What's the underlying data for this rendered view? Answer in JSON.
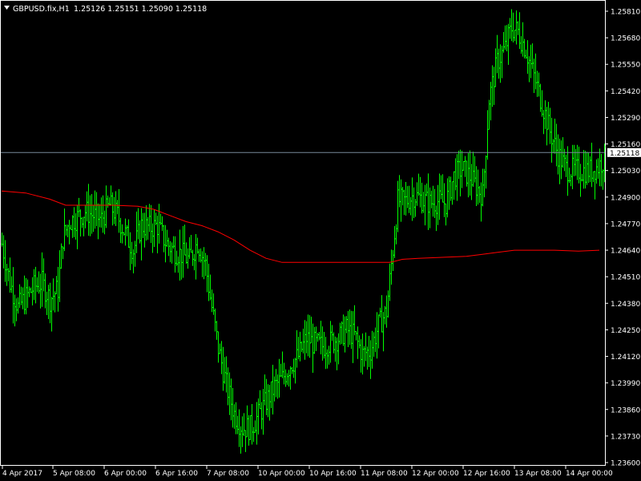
{
  "header": {
    "menu_icon": "triangle-down-icon",
    "symbol": "GBPUSD.fix,H1",
    "ohlc": "1.25126 1.25151 1.25090 1.25118"
  },
  "colors": {
    "background": "#000000",
    "frame": "#ffffff",
    "bars": "#00ff00",
    "moving_average": "#ff0000",
    "bid_line": "#778899",
    "text": "#ffffff"
  },
  "chart_data": {
    "type": "ohlc",
    "symbol": "GBPUSD.fix",
    "timeframe": "H1",
    "current_price": "1.25118",
    "x_tick_labels": [
      "4 Apr 2017",
      "5 Apr 08:00",
      "6 Apr 00:00",
      "6 Apr 16:00",
      "7 Apr 08:00",
      "10 Apr 00:00",
      "10 Apr 16:00",
      "11 Apr 08:00",
      "12 Apr 00:00",
      "12 Apr 16:00",
      "13 Apr 08:00",
      "14 Apr 00:00"
    ],
    "y_tick_labels": [
      "1.25810",
      "1.25680",
      "1.25550",
      "1.25420",
      "1.25290",
      "1.25160",
      "1.25030",
      "1.24900",
      "1.24770",
      "1.24640",
      "1.24510",
      "1.24380",
      "1.24250",
      "1.24120",
      "1.23990",
      "1.23860",
      "1.23730",
      "1.23600"
    ],
    "ylim": [
      1.2358,
      1.2585
    ],
    "grid": false,
    "series": [
      {
        "kind": "price-bars",
        "close_path": [
          [
            0,
            1.2467
          ],
          [
            5,
            1.2448
          ],
          [
            10,
            1.2436
          ],
          [
            15,
            1.2441
          ],
          [
            20,
            1.2446
          ],
          [
            25,
            1.2448
          ],
          [
            30,
            1.244
          ],
          [
            35,
            1.2445
          ],
          [
            38,
            1.247
          ],
          [
            42,
            1.2478
          ],
          [
            47,
            1.248
          ],
          [
            52,
            1.2483
          ],
          [
            57,
            1.2481
          ],
          [
            62,
            1.2479
          ],
          [
            67,
            1.2486
          ],
          [
            72,
            1.2481
          ],
          [
            77,
            1.2472
          ],
          [
            82,
            1.2464
          ],
          [
            87,
            1.2476
          ],
          [
            92,
            1.2475
          ],
          [
            97,
            1.2476
          ],
          [
            102,
            1.2468
          ],
          [
            107,
            1.2464
          ],
          [
            112,
            1.2462
          ],
          [
            117,
            1.2459
          ],
          [
            122,
            1.2468
          ],
          [
            127,
            1.2457
          ],
          [
            130,
            1.2441
          ],
          [
            135,
            1.2416
          ],
          [
            140,
            1.2398
          ],
          [
            145,
            1.2384
          ],
          [
            150,
            1.2377
          ],
          [
            155,
            1.2377
          ],
          [
            160,
            1.2383
          ],
          [
            165,
            1.239
          ],
          [
            170,
            1.2397
          ],
          [
            175,
            1.2401
          ],
          [
            180,
            1.2408
          ],
          [
            185,
            1.2412
          ],
          [
            190,
            1.2421
          ],
          [
            195,
            1.2418
          ],
          [
            200,
            1.2417
          ],
          [
            205,
            1.2419
          ],
          [
            210,
            1.2421
          ],
          [
            215,
            1.2425
          ],
          [
            220,
            1.2422
          ],
          [
            225,
            1.2413
          ],
          [
            230,
            1.2415
          ],
          [
            235,
            1.2427
          ],
          [
            240,
            1.2434
          ],
          [
            243,
            1.2457
          ],
          [
            247,
            1.2488
          ],
          [
            252,
            1.2488
          ],
          [
            257,
            1.2491
          ],
          [
            262,
            1.2489
          ],
          [
            267,
            1.2487
          ],
          [
            272,
            1.2488
          ],
          [
            277,
            1.2487
          ],
          [
            282,
            1.25
          ],
          [
            287,
            1.2504
          ],
          [
            292,
            1.25
          ],
          [
            297,
            1.2494
          ],
          [
            300,
            1.2491
          ],
          [
            304,
            1.2538
          ],
          [
            309,
            1.2556
          ],
          [
            314,
            1.2563
          ],
          [
            318,
            1.2573
          ],
          [
            322,
            1.2571
          ],
          [
            327,
            1.2562
          ],
          [
            332,
            1.2549
          ],
          [
            337,
            1.2536
          ],
          [
            342,
            1.2522
          ],
          [
            347,
            1.2511
          ],
          [
            352,
            1.2504
          ],
          [
            357,
            1.2503
          ],
          [
            362,
            1.2503
          ],
          [
            367,
            1.2503
          ],
          [
            372,
            1.2505
          ],
          [
            376,
            1.2509
          ]
        ]
      },
      {
        "kind": "moving-average",
        "points": [
          [
            0,
            1.2493
          ],
          [
            15,
            1.2492
          ],
          [
            30,
            1.2489
          ],
          [
            40,
            1.2486
          ],
          [
            55,
            1.2486
          ],
          [
            70,
            1.2486
          ],
          [
            85,
            1.24855
          ],
          [
            95,
            1.2484
          ],
          [
            105,
            1.2481
          ],
          [
            115,
            1.2478
          ],
          [
            125,
            1.2476
          ],
          [
            135,
            1.2473
          ],
          [
            145,
            1.2469
          ],
          [
            155,
            1.2464
          ],
          [
            165,
            1.246
          ],
          [
            175,
            1.2458
          ],
          [
            185,
            1.2458
          ],
          [
            200,
            1.2458
          ],
          [
            215,
            1.2458
          ],
          [
            230,
            1.2458
          ],
          [
            242,
            1.2458
          ],
          [
            245,
            1.24585
          ],
          [
            250,
            1.24595
          ],
          [
            260,
            1.246
          ],
          [
            275,
            1.24605
          ],
          [
            290,
            1.2461
          ],
          [
            300,
            1.2462
          ],
          [
            310,
            1.2463
          ],
          [
            320,
            1.2464
          ],
          [
            330,
            1.2464
          ],
          [
            345,
            1.2464
          ],
          [
            360,
            1.24635
          ],
          [
            373,
            1.2464
          ]
        ]
      }
    ]
  }
}
